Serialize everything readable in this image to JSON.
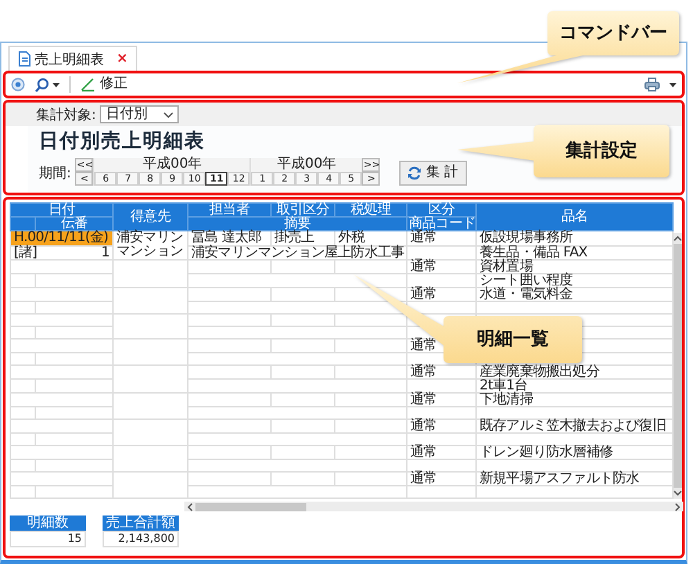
{
  "tab": {
    "label": "売上明細表",
    "close": "×"
  },
  "command_bar": {
    "edit_label": "修正"
  },
  "settings": {
    "target_label": "集計対象:",
    "target_value": "日付別",
    "title": "日付別売上明細表",
    "period_label": "期間:",
    "prev_buttons": [
      "<<",
      "<"
    ],
    "next_buttons": [
      ">>",
      ">"
    ],
    "years": [
      {
        "label": "平成00年",
        "months": [
          {
            "label": "6",
            "selected": false
          },
          {
            "label": "7",
            "selected": false
          },
          {
            "label": "8",
            "selected": false
          },
          {
            "label": "9",
            "selected": false
          },
          {
            "label": "10",
            "selected": false
          },
          {
            "label": "11",
            "selected": true
          },
          {
            "label": "12",
            "selected": false
          }
        ]
      },
      {
        "label": "平成00年",
        "months": [
          {
            "label": "1",
            "selected": false
          },
          {
            "label": "2",
            "selected": false
          },
          {
            "label": "3",
            "selected": false
          },
          {
            "label": "4",
            "selected": false
          },
          {
            "label": "5",
            "selected": false
          }
        ]
      }
    ],
    "run_button": "集 計"
  },
  "table": {
    "header": {
      "date": "日付",
      "slip": "伝番",
      "customer": "得意先",
      "staff": "担当者",
      "trade": "取引区分",
      "tax": "税処理",
      "summary": "摘要",
      "category": "区分",
      "code": "商品コード",
      "item": "品名"
    },
    "rows": [
      {
        "selected": true,
        "date": "H.00/11/11(金)",
        "slip_type": "[諸]",
        "slip": "1",
        "customer": "浦安マリンマンション",
        "staff": "冨島 達太郎",
        "trade": "掛売上",
        "tax": "外税",
        "summary": "浦安マリンマンション屋上防水工事",
        "category": "通常",
        "items": [
          "仮設現場事務所",
          "養生品・備品 FAX"
        ]
      },
      {
        "selected": false,
        "category": "通常",
        "items": [
          "資材置場",
          "シート囲い程度"
        ]
      },
      {
        "selected": false,
        "category": "通常",
        "items": [
          "水道・電気料金"
        ]
      },
      {
        "selected": false
      },
      {
        "selected": false,
        "category": "通常"
      },
      {
        "selected": false,
        "category": "通常",
        "items": [
          "産業廃棄物搬出処分",
          "2t車1台"
        ]
      },
      {
        "selected": false,
        "category": "通常",
        "items": [
          "下地清掃"
        ]
      },
      {
        "selected": false,
        "category": "通常",
        "items": [
          "既存アルミ笠木撤去および復旧"
        ]
      },
      {
        "selected": false,
        "category": "通常",
        "items": [
          "ドレン廻り防水層補修"
        ]
      },
      {
        "selected": false,
        "category": "通常",
        "items": [
          "新規平場アスファルト防水"
        ]
      }
    ]
  },
  "footer": [
    {
      "label": "明細数",
      "value": "15"
    },
    {
      "label": "売上合計額",
      "value": "2,143,800"
    }
  ],
  "callouts": [
    {
      "text": "コマンドバー"
    },
    {
      "text": "集計設定"
    },
    {
      "text": "明細一覧"
    }
  ]
}
